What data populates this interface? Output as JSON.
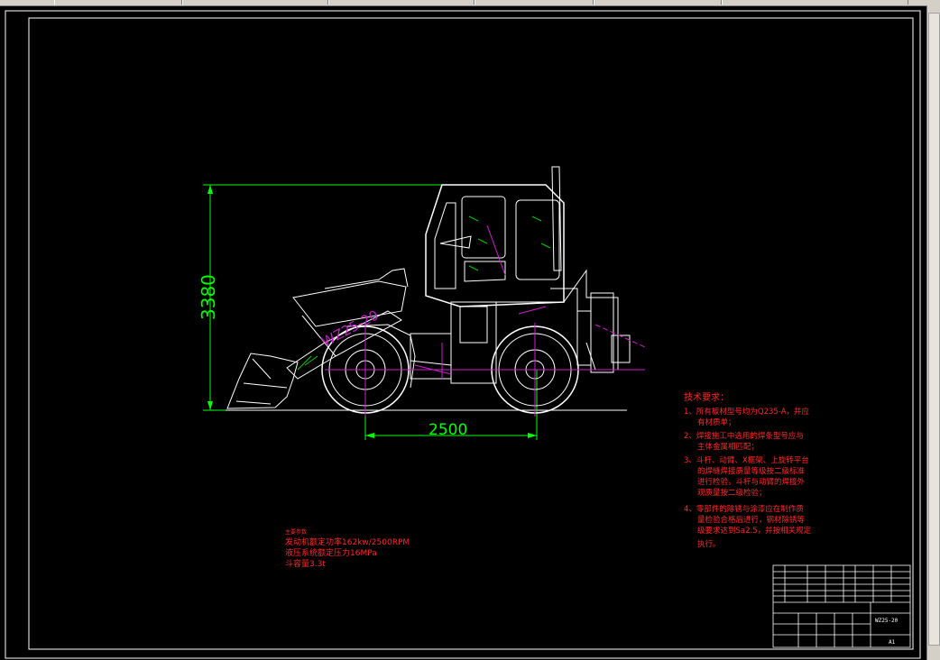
{
  "window": {
    "toolbar_segments": 6
  },
  "drawing": {
    "model_label": "WZ25-20",
    "dimensions": {
      "height": "3380",
      "wheelbase": "2500"
    }
  },
  "tech_notes": {
    "title": "技术要求：",
    "items": [
      "1、所有板材型号均为Q235-A，并应",
      "有材质单；",
      "2、焊接施工中选用的焊条型号应与",
      "主体金属相匹配；",
      "3、斗杆、动臂、X框架、上旋转平台",
      "的焊缝焊接质量等级按二级标准",
      "进行检验，斗杆与动臂的焊接外",
      "观质量按二级检验；",
      "4、零部件的除锈与涂漆应在制作质",
      "量检验合格后进行，钢材除锈等",
      "级要求达到Sa2.5，并按相关规定",
      "执行。"
    ]
  },
  "specs": {
    "title": "主要参数",
    "engine": "发动机额定功率162kw/2500RPM",
    "pressure": "液压系统额定压力16MPa",
    "bucket": "斗容量3.3t"
  },
  "title_block": {
    "drawing_no": "WZ25-20",
    "sheet_size": "A1"
  }
}
